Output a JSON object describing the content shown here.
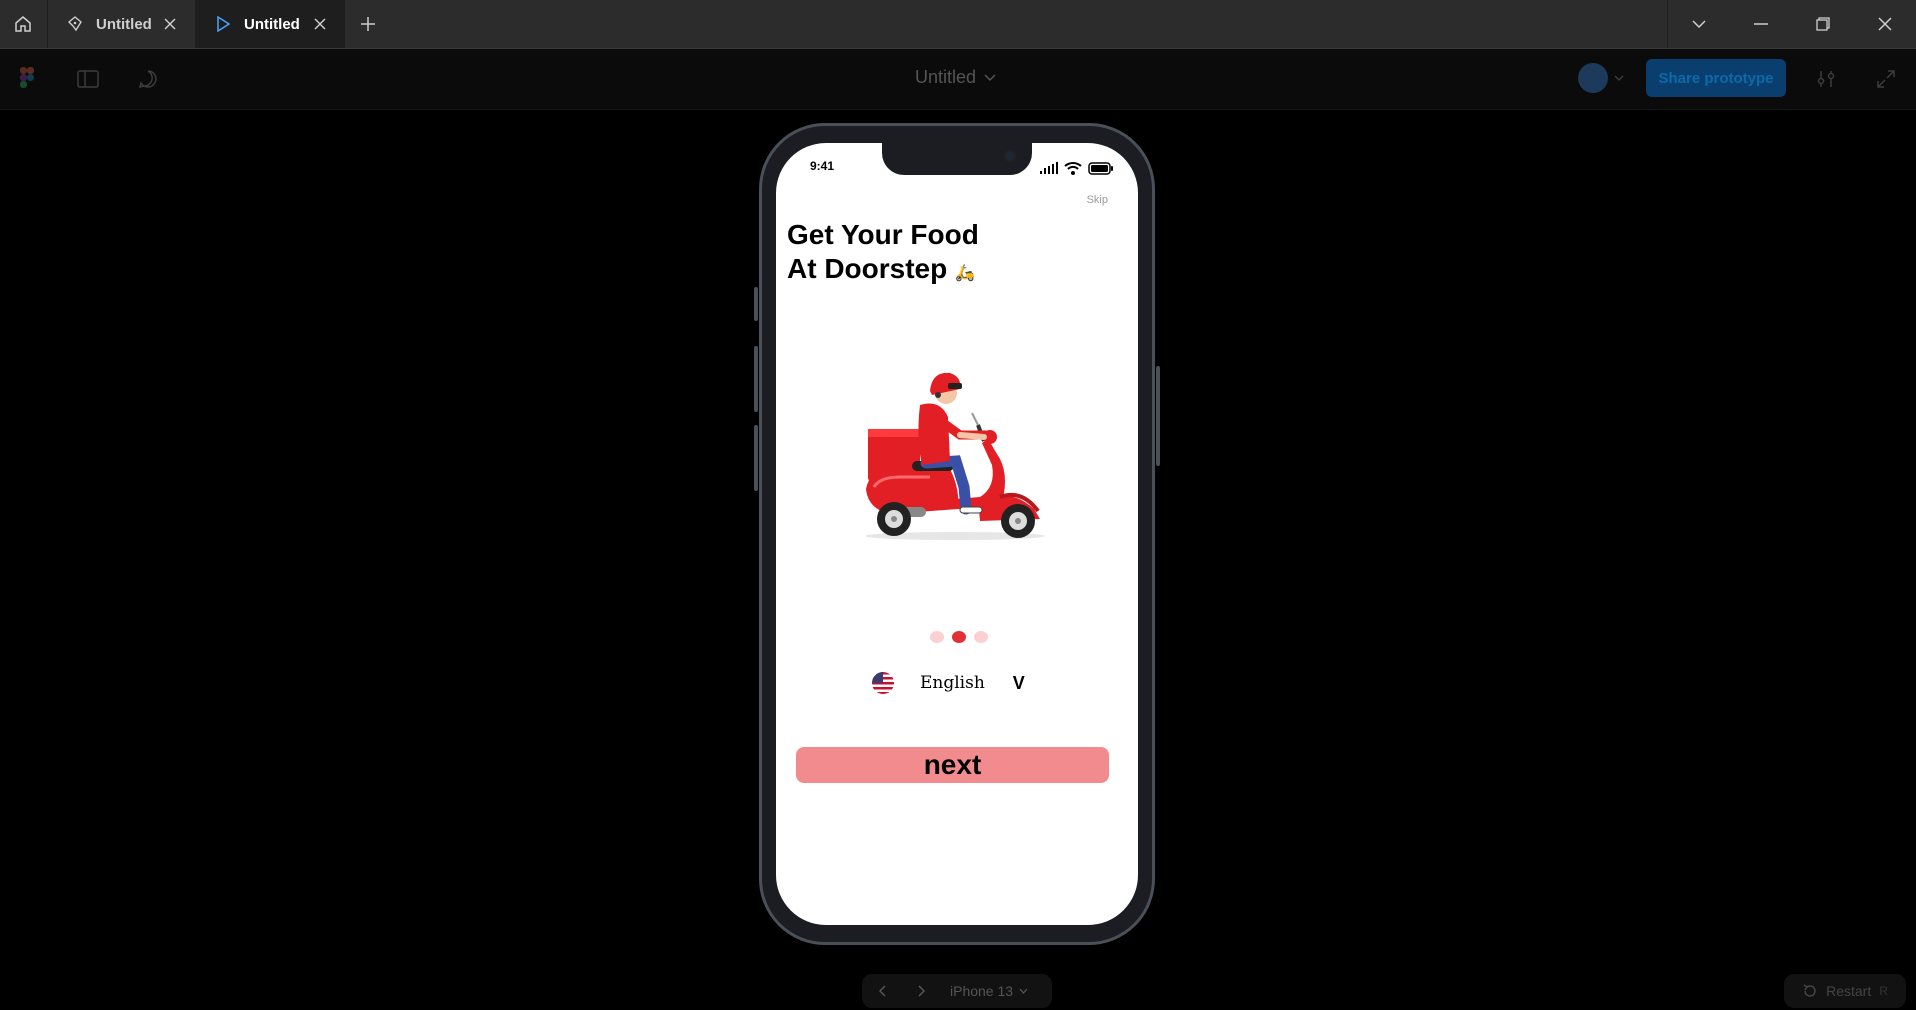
{
  "titlebar": {
    "tabs": [
      {
        "label": "Untitled",
        "icon": "design-file-icon"
      },
      {
        "label": "Untitled",
        "icon": "play-prototype-icon"
      }
    ]
  },
  "toolbar": {
    "doc_title": "Untitled",
    "share_label": "Share prototype"
  },
  "phone": {
    "time": "9:41",
    "skip_label": "Skip",
    "headline_line1": "Get Your Food",
    "headline_line2": "At Doorstep",
    "headline_emoji": "🛵",
    "dots": {
      "count": 3,
      "active_index": 1
    },
    "language": "English",
    "language_chevron": "V",
    "next_label": "next"
  },
  "bottom": {
    "device_label": "iPhone 13",
    "restart_label": "Restart",
    "restart_shortcut": "R"
  },
  "colors": {
    "accent_red": "#e32f35",
    "next_button": "#f28b8e",
    "share_button": "#0a3e6e"
  }
}
